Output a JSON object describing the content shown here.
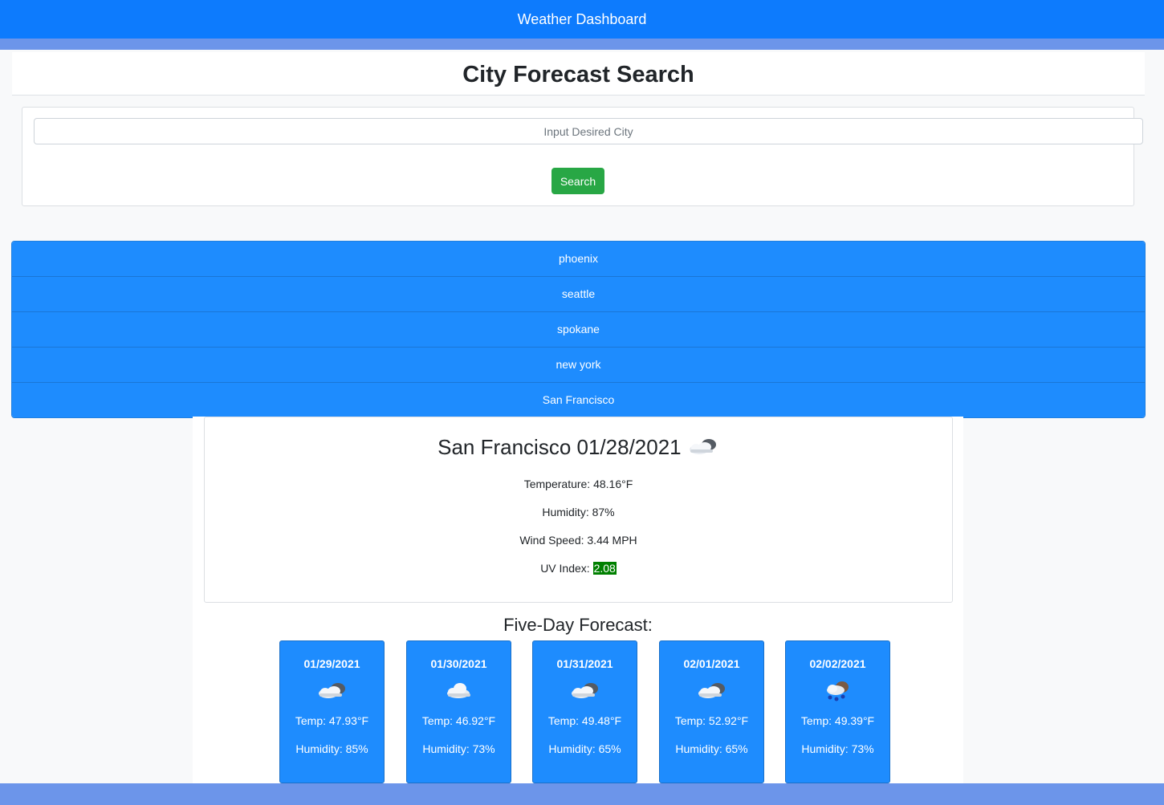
{
  "navbar": {
    "title": "Weather Dashboard"
  },
  "header": {
    "title": "City Forecast Search"
  },
  "search": {
    "placeholder": "Input Desired City",
    "value": "",
    "button_label": "Search"
  },
  "history": [
    "phoenix",
    "seattle",
    "spokane",
    "new york",
    "San Francisco"
  ],
  "current": {
    "title": "San Francisco 01/28/2021",
    "icon": "partly-cloudy-icon",
    "temperature": "Temperature: 48.16°F",
    "humidity": "Humidity: 87%",
    "wind": "Wind Speed: 3.44 MPH",
    "uv_label": "UV Index: ",
    "uv_value": "2.08",
    "uv_color": "#008000"
  },
  "forecast_title": "Five-Day Forecast:",
  "forecast": [
    {
      "date": "01/29/2021",
      "icon": "partly-cloudy-icon",
      "temp": "Temp: 47.93°F",
      "humidity": "Humidity: 85%"
    },
    {
      "date": "01/30/2021",
      "icon": "cloud-icon",
      "temp": "Temp: 46.92°F",
      "humidity": "Humidity: 73%"
    },
    {
      "date": "01/31/2021",
      "icon": "partly-cloudy-icon",
      "temp": "Temp: 49.48°F",
      "humidity": "Humidity: 65%"
    },
    {
      "date": "02/01/2021",
      "icon": "partly-cloudy-icon",
      "temp": "Temp: 52.92°F",
      "humidity": "Humidity: 65%"
    },
    {
      "date": "02/02/2021",
      "icon": "rain-icon",
      "temp": "Temp: 49.39°F",
      "humidity": "Humidity: 73%"
    }
  ],
  "colors": {
    "navbar": "#0d7bfd",
    "list_item": "#1e8cfe",
    "search_button": "#28a745",
    "stripe": "#6c95ea"
  }
}
